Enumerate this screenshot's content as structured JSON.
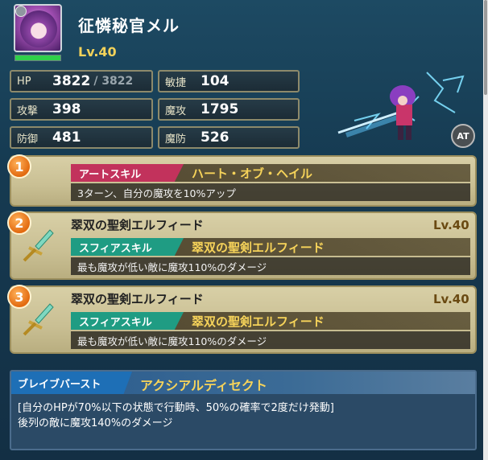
{
  "unit": {
    "name": "征憐秘官メル",
    "level": "Lv.40",
    "hp_fill_fraction": 1.0
  },
  "stats": {
    "hp": {
      "label": "HP",
      "value": "3822",
      "max": "/ 3822"
    },
    "agility": {
      "label": "敏捷",
      "value": "104"
    },
    "attack": {
      "label": "攻撃",
      "value": "398"
    },
    "magic_attack": {
      "label": "魔攻",
      "value": "1795"
    },
    "defense": {
      "label": "防御",
      "value": "481"
    },
    "magic_defense": {
      "label": "魔防",
      "value": "526"
    }
  },
  "at_badge": "AT",
  "skills": [
    {
      "number": "1",
      "tag": "アートスキル",
      "tag_color": "#c2325c",
      "name": "ハート・オブ・ヘイル",
      "description": "3ターン、自分の魔攻を10%アップ"
    },
    {
      "number": "2",
      "title": "翠双の聖剣エルフィード",
      "level": "Lv.40",
      "tag": "スフィアスキル",
      "tag_color": "#1f9c83",
      "name": "翠双の聖剣エルフィード",
      "description": "最も魔攻が低い敵に魔攻110%のダメージ"
    },
    {
      "number": "3",
      "title": "翠双の聖剣エルフィード",
      "level": "Lv.40",
      "tag": "スフィアスキル",
      "tag_color": "#1f9c83",
      "name": "翠双の聖剣エルフィード",
      "description": "最も魔攻が低い敵に魔攻110%のダメージ"
    }
  ],
  "brave_burst": {
    "tag": "ブレイブバースト",
    "name": "アクシアルディセクト",
    "description_line1": "[自分のHPが70%以下の状態で行動時、50%の確率で2度だけ発動]",
    "description_line2": "後列の敵に魔攻140%のダメージ"
  },
  "colors": {
    "level_text": "#f3d25a",
    "skill_name": "#f6d35a",
    "hp_bar": "#2fd04a",
    "brave_tag": "#1e6fb6"
  }
}
